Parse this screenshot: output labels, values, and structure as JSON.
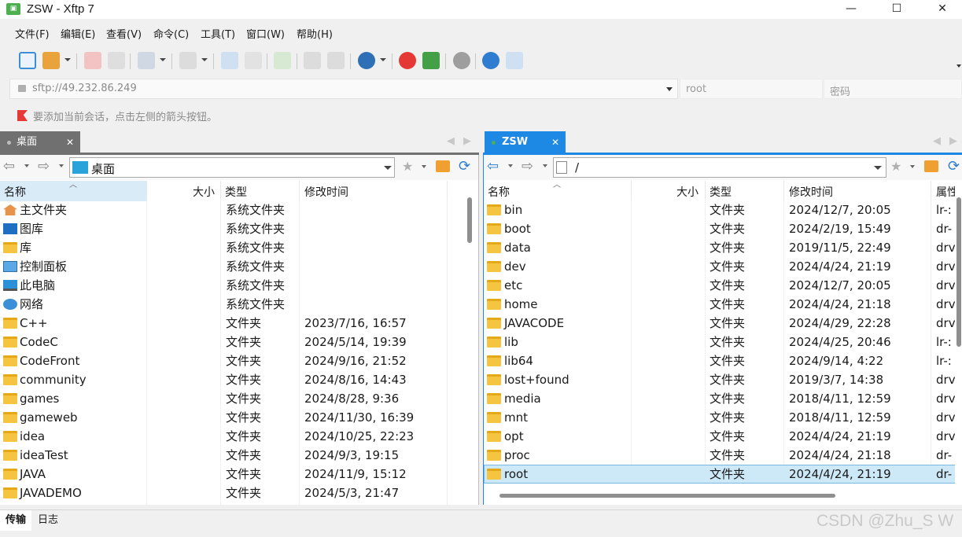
{
  "window": {
    "title": "ZSW - Xftp 7",
    "app_icon": "xftp-app-icon",
    "minimize": "—",
    "maximize": "☐",
    "close": "✕"
  },
  "menu": [
    "文件(F)",
    "编辑(E)",
    "查看(V)",
    "命令(C)",
    "工具(T)",
    "窗口(W)",
    "帮助(H)"
  ],
  "toolbar_icons": [
    "new-session-icon",
    "open-folder-icon",
    "disconnect-icon",
    "reconnect-icon",
    "new-window-icon",
    "transfer-queue-icon",
    "upload-icon",
    "download-icon",
    "sync-icon",
    "copy-icon",
    "paste-icon",
    "web-icon",
    "xshell-icon",
    "xftp-icon",
    "settings-icon",
    "help-icon",
    "chat-icon"
  ],
  "address": {
    "value": "sftp://49.232.86.249",
    "user_placeholder": "root",
    "password_placeholder": "密码"
  },
  "hint": "要添加当前会话，点击左侧的箭头按钮。",
  "left": {
    "tab": "桌面",
    "path": "桌面",
    "columns": [
      "名称",
      "大小",
      "类型",
      "修改时间"
    ],
    "rows": [
      {
        "icon": "home-icon",
        "name": "主文件夹",
        "type": "系统文件夹",
        "mtime": ""
      },
      {
        "icon": "gallery-icon",
        "name": "图库",
        "type": "系统文件夹",
        "mtime": ""
      },
      {
        "icon": "folder-icon",
        "name": "库",
        "type": "系统文件夹",
        "mtime": ""
      },
      {
        "icon": "control-panel-icon",
        "name": "控制面板",
        "type": "系统文件夹",
        "mtime": ""
      },
      {
        "icon": "computer-icon",
        "name": "此电脑",
        "type": "系统文件夹",
        "mtime": ""
      },
      {
        "icon": "network-icon",
        "name": "网络",
        "type": "系统文件夹",
        "mtime": ""
      },
      {
        "icon": "folder-icon",
        "name": "C++",
        "type": "文件夹",
        "mtime": "2023/7/16, 16:57"
      },
      {
        "icon": "folder-icon",
        "name": "CodeC",
        "type": "文件夹",
        "mtime": "2024/5/14, 19:39"
      },
      {
        "icon": "folder-icon",
        "name": "CodeFront",
        "type": "文件夹",
        "mtime": "2024/9/16, 21:52"
      },
      {
        "icon": "folder-icon",
        "name": "community",
        "type": "文件夹",
        "mtime": "2024/8/16, 14:43"
      },
      {
        "icon": "folder-icon",
        "name": "games",
        "type": "文件夹",
        "mtime": "2024/8/28, 9:36"
      },
      {
        "icon": "folder-icon",
        "name": "gameweb",
        "type": "文件夹",
        "mtime": "2024/11/30, 16:39"
      },
      {
        "icon": "folder-icon",
        "name": "idea",
        "type": "文件夹",
        "mtime": "2024/10/25, 22:23"
      },
      {
        "icon": "folder-icon",
        "name": "ideaTest",
        "type": "文件夹",
        "mtime": "2024/9/3, 19:15"
      },
      {
        "icon": "folder-icon",
        "name": "JAVA",
        "type": "文件夹",
        "mtime": "2024/11/9, 15:12"
      },
      {
        "icon": "folder-icon",
        "name": "JAVADEMO",
        "type": "文件夹",
        "mtime": "2024/5/3, 21:47"
      }
    ]
  },
  "right": {
    "tab": "ZSW",
    "path": "/",
    "columns": [
      "名称",
      "大小",
      "类型",
      "修改时间",
      "属性"
    ],
    "rows": [
      {
        "icon": "folder-link-icon",
        "name": "bin",
        "type": "文件夹",
        "mtime": "2024/12/7, 20:05",
        "attr": "lr-:"
      },
      {
        "icon": "folder-icon",
        "name": "boot",
        "type": "文件夹",
        "mtime": "2024/2/19, 15:49",
        "attr": "dr-"
      },
      {
        "icon": "folder-icon",
        "name": "data",
        "type": "文件夹",
        "mtime": "2019/11/5, 22:49",
        "attr": "drv"
      },
      {
        "icon": "folder-icon",
        "name": "dev",
        "type": "文件夹",
        "mtime": "2024/4/24, 21:19",
        "attr": "drv"
      },
      {
        "icon": "folder-icon",
        "name": "etc",
        "type": "文件夹",
        "mtime": "2024/12/7, 20:05",
        "attr": "drv"
      },
      {
        "icon": "folder-icon",
        "name": "home",
        "type": "文件夹",
        "mtime": "2024/4/24, 21:18",
        "attr": "drv"
      },
      {
        "icon": "folder-icon",
        "name": "JAVACODE",
        "type": "文件夹",
        "mtime": "2024/4/29, 22:28",
        "attr": "drv"
      },
      {
        "icon": "folder-link-icon",
        "name": "lib",
        "type": "文件夹",
        "mtime": "2024/4/25, 20:46",
        "attr": "lr-:"
      },
      {
        "icon": "folder-link-icon",
        "name": "lib64",
        "type": "文件夹",
        "mtime": "2024/9/14, 4:22",
        "attr": "lr-:"
      },
      {
        "icon": "folder-icon",
        "name": "lost+found",
        "type": "文件夹",
        "mtime": "2019/3/7, 14:38",
        "attr": "drv"
      },
      {
        "icon": "folder-icon",
        "name": "media",
        "type": "文件夹",
        "mtime": "2018/4/11, 12:59",
        "attr": "drv"
      },
      {
        "icon": "folder-icon",
        "name": "mnt",
        "type": "文件夹",
        "mtime": "2018/4/11, 12:59",
        "attr": "drv"
      },
      {
        "icon": "folder-icon",
        "name": "opt",
        "type": "文件夹",
        "mtime": "2024/4/24, 21:19",
        "attr": "drv"
      },
      {
        "icon": "folder-icon",
        "name": "proc",
        "type": "文件夹",
        "mtime": "2024/4/24, 21:18",
        "attr": "dr-"
      },
      {
        "icon": "folder-icon",
        "name": "root",
        "type": "文件夹",
        "mtime": "2024/4/24, 21:19",
        "attr": "dr-",
        "selected": true
      }
    ]
  },
  "bottom_tabs": [
    "传输",
    "日志"
  ],
  "watermark": "CSDN @Zhu_S W",
  "colors": {
    "accent": "#1e88e5",
    "folder": "#f5c542",
    "selection": "#cde8f7"
  }
}
